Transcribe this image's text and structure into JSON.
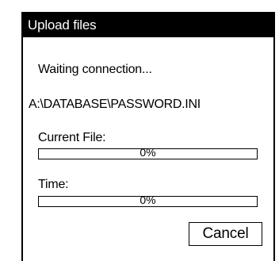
{
  "dialog": {
    "title": "Upload files",
    "status": "Waiting connection...",
    "file_path": "A:\\DATABASE\\PASSWORD.INI",
    "current_file": {
      "label": "Current File:",
      "progress_text": "0%",
      "progress_fraction": 0
    },
    "time": {
      "label": "Time:",
      "progress_text": "0%",
      "progress_fraction": 0
    },
    "cancel_label": "Cancel"
  }
}
